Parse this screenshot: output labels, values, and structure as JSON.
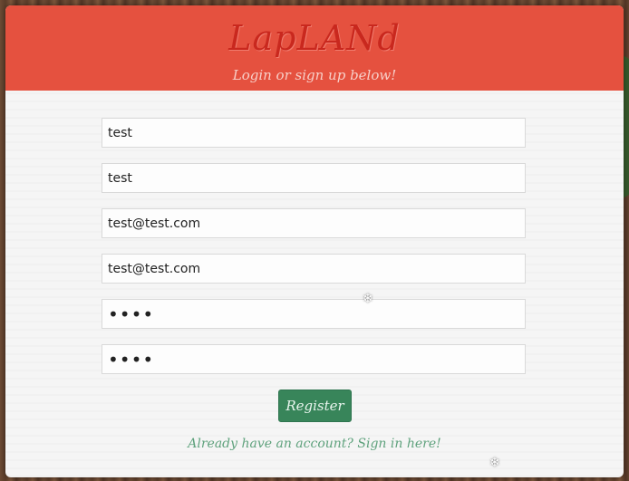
{
  "header": {
    "logo": "LapLANd",
    "subtitle": "Login or sign up below!"
  },
  "form": {
    "fields": [
      {
        "value": "test"
      },
      {
        "value": "test"
      },
      {
        "value": "test@test.com"
      },
      {
        "value": "test@test.com"
      },
      {
        "value": "••••"
      },
      {
        "value": "••••"
      }
    ],
    "register_label": "Register",
    "signin_link": "Already have an account? Sign in here!"
  },
  "decor": {
    "snowflake": "❄"
  },
  "colors": {
    "header": "#e5513f",
    "logo": "#c9281e",
    "button": "#38855a",
    "link": "#5fa27d"
  }
}
